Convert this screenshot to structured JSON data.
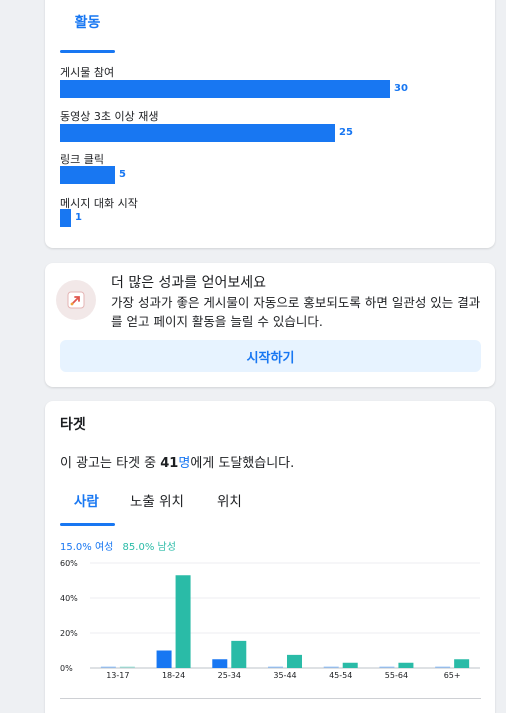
{
  "activity": {
    "tab_label": "활동",
    "metrics": [
      {
        "label": "게시물 참여",
        "value": 30
      },
      {
        "label": "동영상 3초 이상 재생",
        "value": 25
      },
      {
        "label": "링크 클릭",
        "value": 5
      },
      {
        "label": "메시지 대화 시작",
        "value": 1
      }
    ],
    "max_value": 30
  },
  "promo": {
    "icon": "rocket-icon",
    "title": "더 많은 성과를 얻어보세요",
    "description": "가장 성과가 좋은 게시물이 자동으로 홍보되도록 하면 일관성 있는 결과를 얻고 페이지 활동을 늘릴 수 있습니다.",
    "button_label": "시작하기"
  },
  "target": {
    "title": "타겟",
    "reach_prefix": "이 광고는 타겟 중 ",
    "reach_number": "41",
    "reach_unit": "명",
    "reach_suffix": "에게 도달했습니다.",
    "tabs": [
      {
        "label": "사람",
        "active": true
      },
      {
        "label": "노출 위치",
        "active": false
      },
      {
        "label": "위치",
        "active": false
      }
    ],
    "legend": {
      "female": "15.0% 여성",
      "male": "85.0% 남성"
    },
    "colors": {
      "female": "#1877f2",
      "male": "#2abba7"
    }
  },
  "chart_data": {
    "type": "bar",
    "categories": [
      "13-17",
      "18-24",
      "25-34",
      "35-44",
      "45-54",
      "55-64",
      "65+"
    ],
    "series": [
      {
        "name": "여성",
        "values": [
          0.5,
          10,
          5,
          0.5,
          0.5,
          0.5,
          0.5
        ]
      },
      {
        "name": "남성",
        "values": [
          0.5,
          53,
          15.5,
          7.5,
          3,
          3,
          5
        ]
      }
    ],
    "yticks": [
      "60%",
      "40%",
      "20%",
      "0%"
    ],
    "ylim": [
      0,
      60
    ],
    "grid": true
  }
}
